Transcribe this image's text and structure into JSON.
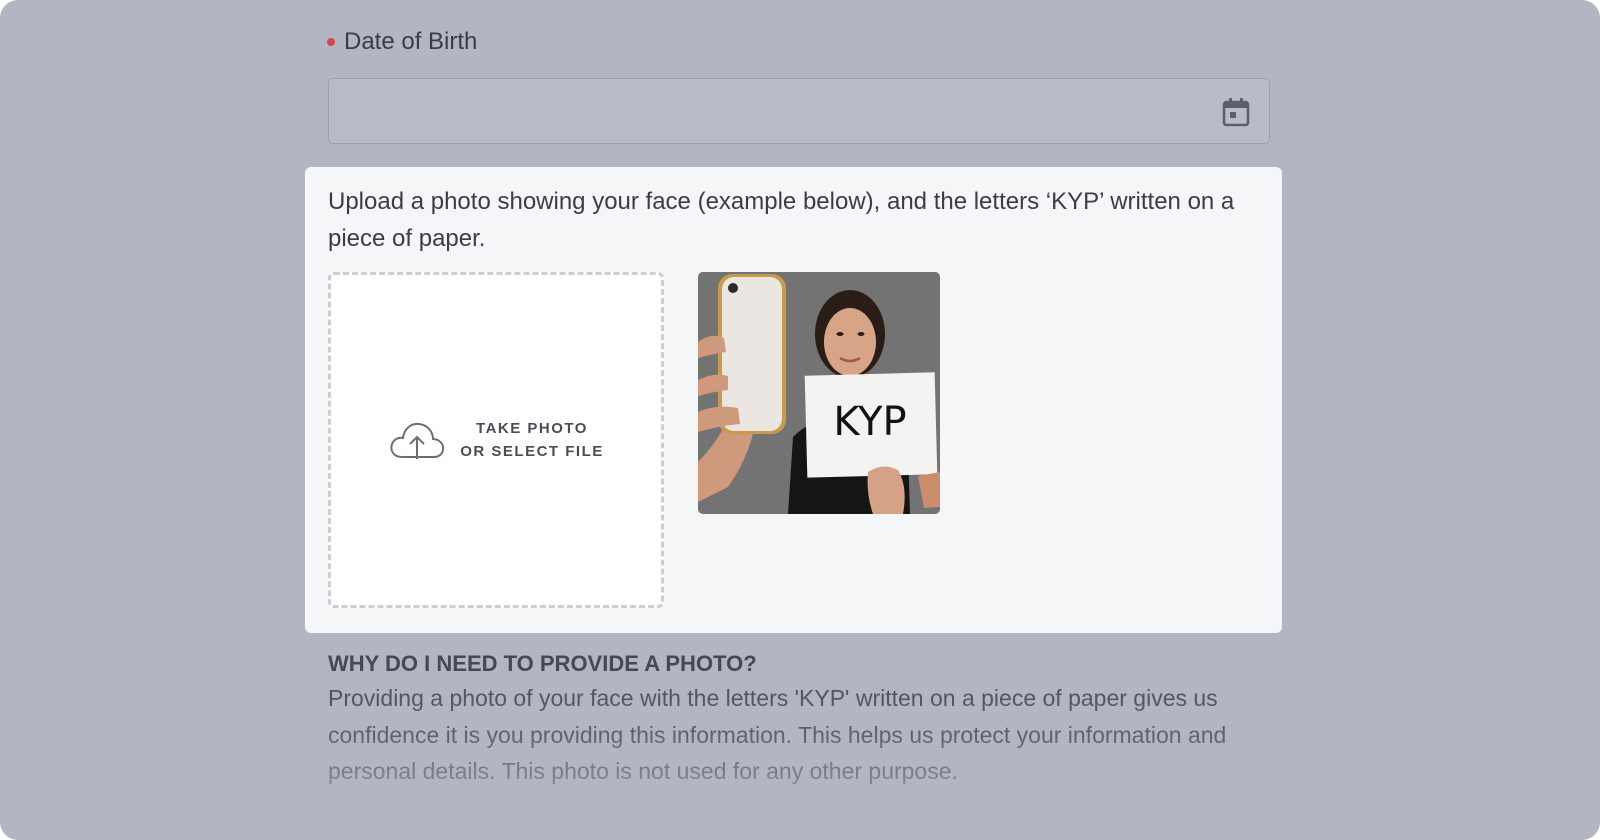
{
  "dob": {
    "label": "Date of Birth",
    "value": "",
    "icon": "calendar-icon"
  },
  "upload": {
    "instructions": "Upload a photo showing your face (example below), and the letters ‘KYP’ written on a piece of paper.",
    "dropzone_line1": "TAKE PHOTO",
    "dropzone_line2": "OR SELECT FILE",
    "dropzone_icon": "cloud-upload-icon",
    "example_sign_text": "KYP"
  },
  "why": {
    "heading": "WHY DO I NEED TO PROVIDE A PHOTO?",
    "body": "Providing a photo of your face with the letters 'KYP' written on a piece of paper gives us confidence it is you providing this information. This helps us protect your information and personal details. This photo is not used for any other purpose."
  },
  "colors": {
    "required_dot": "#d04858",
    "overlay_background": "#b2b5c2",
    "card_background": "#f5f6f8"
  }
}
